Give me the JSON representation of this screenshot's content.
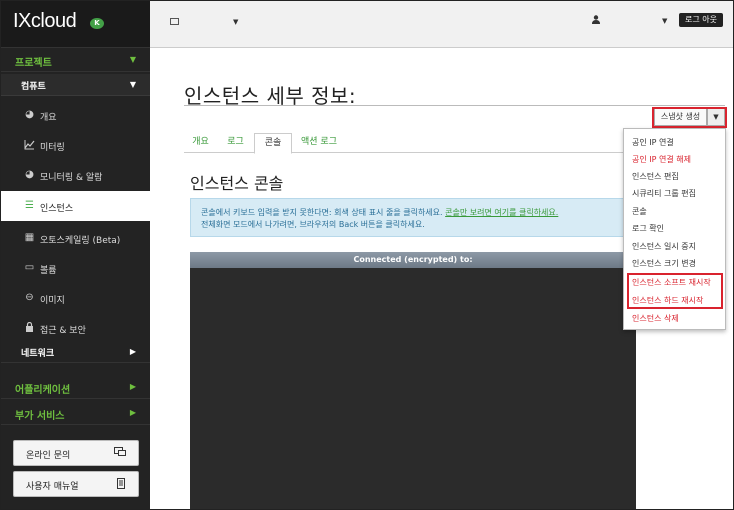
{
  "app": {
    "logo_text": "IXcloud",
    "logo_badge": "K",
    "accent_color": "#6fbf3f",
    "alert_color": "#d9232e"
  },
  "sidebar": {
    "sections": [
      {
        "label": "프로젝트",
        "arrow": "▼"
      },
      {
        "label": "컴퓨트",
        "arrow": "▼"
      }
    ],
    "items": [
      {
        "label": "개요",
        "icon": "pie-chart-icon"
      },
      {
        "label": "미터링",
        "icon": "line-chart-icon"
      },
      {
        "label": "모니터링 & 알람",
        "icon": "pie-chart-icon"
      },
      {
        "label": "인스턴스",
        "icon": "list-icon",
        "active": true
      },
      {
        "label": "오토스케일링 (Beta)",
        "icon": "grid-icon"
      },
      {
        "label": "볼륨",
        "icon": "drive-icon"
      },
      {
        "label": "이미지",
        "icon": "disc-icon"
      },
      {
        "label": "접근 & 보안",
        "icon": "lock-icon"
      }
    ],
    "network": {
      "label": "네트워크",
      "arrow": "▶"
    },
    "apps": {
      "label": "어플리케이션",
      "arrow": "▶"
    },
    "extra": {
      "label": "부가 서비스",
      "arrow": "▶"
    },
    "buttons": [
      {
        "label": "온라인 문의",
        "icon": "chat-icon"
      },
      {
        "label": "사용자 매뉴얼",
        "icon": "book-icon"
      }
    ]
  },
  "topbar": {
    "logout_label": "로그 아웃"
  },
  "main": {
    "title": "인스턴스 세부 정보:",
    "snapshot_label": "스냅샷 생성",
    "tabs": [
      {
        "label": "개요"
      },
      {
        "label": "로그"
      },
      {
        "label": "콘솔",
        "active": true
      },
      {
        "label": "액션 로그"
      }
    ],
    "console_title": "인스턴스 콘솔",
    "info_text_1": "콘솔에서 키보드 입력을 받지 못한다면: 회색 상태 표시 줄을 클릭하세요.",
    "info_link": "콘솔만 보려면 여기를 클릭하세요.",
    "info_text_2": "전체화면 모드에서 나가려면, 브라우저의 Back 버튼을 클릭하세요.",
    "console_status": "Connected (encrypted) to:"
  },
  "dropdown": {
    "items": [
      {
        "label": "공인 IP 연결"
      },
      {
        "label": "공인 IP 연결 해제",
        "red": true
      },
      {
        "label": "인스턴스 편집"
      },
      {
        "label": "시큐리티 그룹 편집"
      },
      {
        "label": "콘솔"
      },
      {
        "label": "로그 확인"
      },
      {
        "label": "인스턴스 일시 중지"
      },
      {
        "label": "인스턴스 크기 변경"
      },
      {
        "label": "인스턴스 소프트 재시작",
        "red": true
      },
      {
        "label": "인스턴스 하드 재시작",
        "red": true
      },
      {
        "label": "인스턴스 삭제",
        "red": true
      }
    ]
  }
}
